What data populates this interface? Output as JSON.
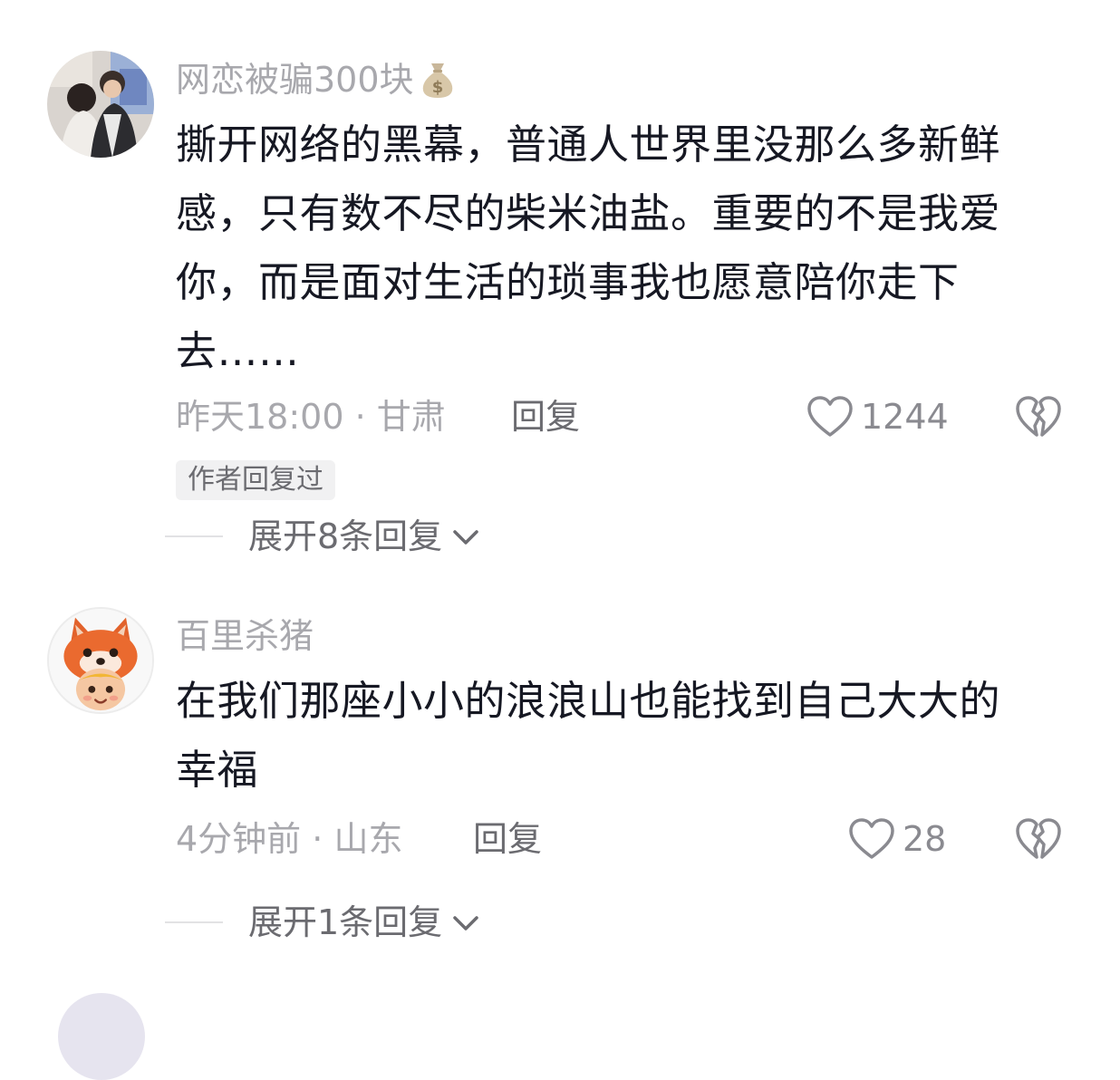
{
  "comments": [
    {
      "username": "网恋被骗300块",
      "username_emoji": "money-bag",
      "text_lines": [
        "撕开网络的黑幕，普通人世界里没那么多新鲜",
        "感，只有数不尽的柴米油盐。重要的不是我爱",
        "你，而是面对生活的琐事我也愿意陪你走下",
        "去……"
      ],
      "time": "昨天18:00",
      "location": "甘肃",
      "meta_sep": " · ",
      "reply_label": "回复",
      "likes": "1244",
      "badge": "作者回复过",
      "expand_label": "展开8条回复"
    },
    {
      "username": "百里杀猪",
      "text_lines": [
        "在我们那座小小的浪浪山也能找到自己大大的",
        "幸福"
      ],
      "time": "4分钟前",
      "location": "山东",
      "meta_sep": " · ",
      "reply_label": "回复",
      "likes": "28",
      "expand_label": "展开1条回复"
    }
  ],
  "icons": {
    "like": "heart-outline-icon",
    "dislike": "broken-heart-icon",
    "expand": "chevron-down-icon"
  },
  "colors": {
    "text": "#161823",
    "secondary": "#a8a8ad",
    "action": "#6b6b70",
    "badge_bg": "#f1f1f2"
  }
}
